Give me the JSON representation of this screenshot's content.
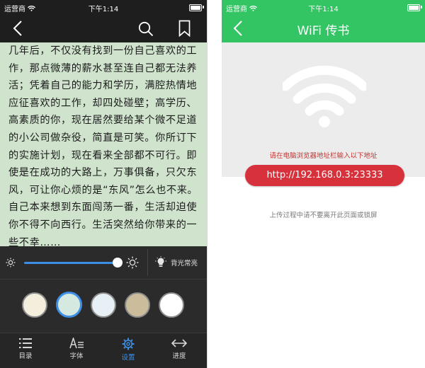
{
  "reader": {
    "status": {
      "carrier": "运营商",
      "time": "下午1:14"
    },
    "paragraphs": [
      "几年后，不仅没有找到一份自己喜欢的工作，那点微薄的薪水甚至连自己都无法养活；凭着自己的能力和学历，满腔热情地应征喜欢的工作，却四处碰壁；高学历、高素质的你，现在居然要给某个微不足道的小公司做杂役，简直是可笑。你所订下的实施计划，现在看来全部都不可行。即使是在成功的大路上，万事俱备，只欠东风，可让你心烦的是“东风”怎么也不来。自己本来想到东面闯荡一番，生活却迫使你不得不向西行。生活突然给你带来的一些不幸……"
    ],
    "brightness": {
      "level_percent": 100
    },
    "backlight_label": "背光常亮",
    "themes": [
      {
        "color": "#f3efdc",
        "selected": false
      },
      {
        "color": "#d6e9e1",
        "selected": true
      },
      {
        "color": "#e6f0f5",
        "selected": false
      },
      {
        "color": "#cbbd9c",
        "selected": false
      },
      {
        "color": "#ffffff",
        "selected": false
      }
    ],
    "tabs": [
      {
        "label": "目录",
        "icon": "list-icon",
        "active": false
      },
      {
        "label": "字体",
        "icon": "font-icon",
        "active": false
      },
      {
        "label": "设置",
        "icon": "gear-icon",
        "active": true
      },
      {
        "label": "进度",
        "icon": "progress-arrows-icon",
        "active": false
      }
    ],
    "colors": {
      "bg": "#cfe3cd",
      "bar": "#1e1e1e",
      "accent": "#3d8fe6"
    }
  },
  "wifi": {
    "status": {
      "carrier": "运营商",
      "time": "下午1:14"
    },
    "title": "WiFi 传书",
    "hint": "请在电脑浏览器地址栏输入以下地址",
    "url": "http://192.168.0.3:23333",
    "note": "上传过程中请不要离开此页面或锁屏",
    "colors": {
      "header": "#33c464",
      "pill": "#d7313b",
      "hint": "#c8332e"
    }
  }
}
